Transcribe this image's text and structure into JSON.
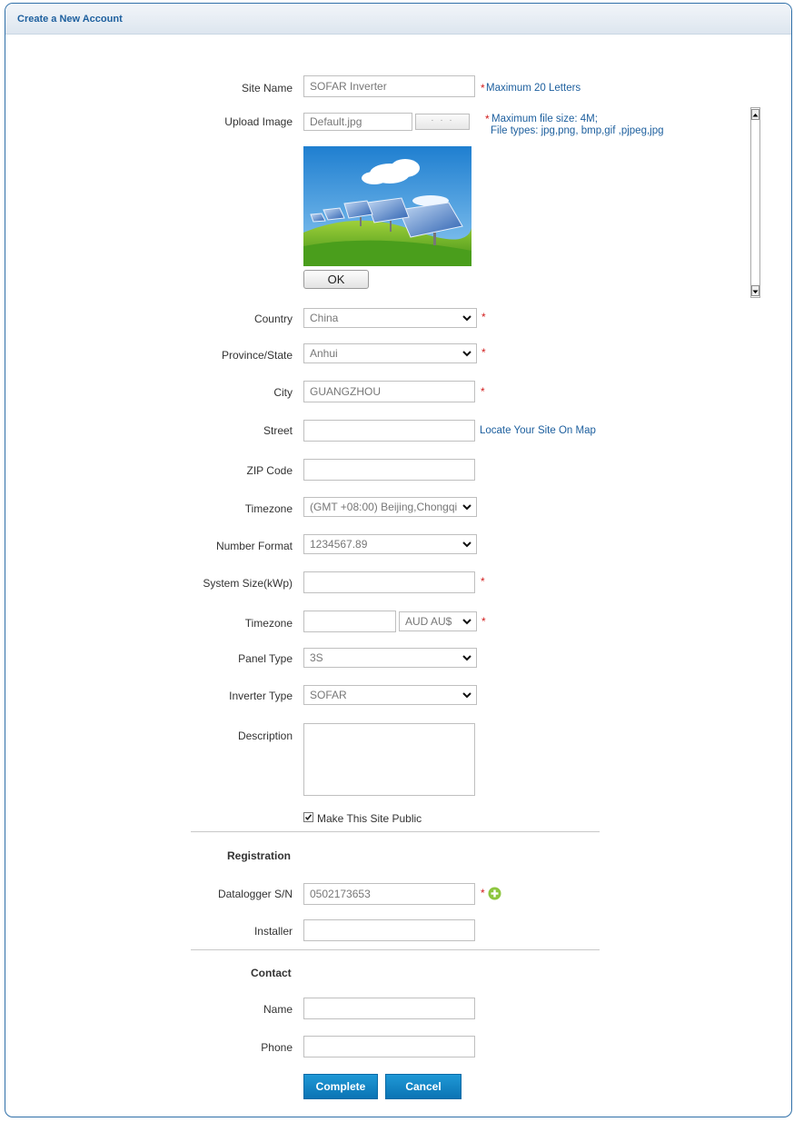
{
  "header": {
    "title": "Create a New Account"
  },
  "site_name": {
    "label": "Site Name",
    "value": "SOFAR Inverter",
    "note": "Maximum 20 Letters"
  },
  "upload_image": {
    "label": "Upload Image",
    "value": "Default.jpg",
    "browse_label": "· · ·",
    "note_line1": "Maximum file size: 4M;",
    "note_line2": "File types: jpg,png, bmp,gif ,pjpeg,jpg",
    "ok_label": "OK"
  },
  "country": {
    "label": "Country",
    "value": "China"
  },
  "province": {
    "label": "Province/State",
    "value": "Anhui"
  },
  "city": {
    "label": "City",
    "value": "GUANGZHOU"
  },
  "street": {
    "label": "Street",
    "value": "",
    "link": "Locate Your Site On Map"
  },
  "zip": {
    "label": "ZIP Code",
    "value": ""
  },
  "timezone": {
    "label": "Timezone",
    "value": "(GMT +08:00) Beijing,Chongqi"
  },
  "number_format": {
    "label": "Number Format",
    "value": "1234567.89"
  },
  "system_size": {
    "label": "System Size(kWp)",
    "value": ""
  },
  "currency": {
    "label": "Timezone",
    "value": "",
    "currency": "AUD AU$"
  },
  "panel_type": {
    "label": "Panel Type",
    "value": "3S"
  },
  "inverter_type": {
    "label": "Inverter Type",
    "value": "SOFAR"
  },
  "description": {
    "label": "Description",
    "value": ""
  },
  "public": {
    "label": "Make This Site Public",
    "checked": true
  },
  "registration": {
    "title": "Registration",
    "datalogger_label": "Datalogger S/N",
    "datalogger_value": "0502173653",
    "installer_label": "Installer",
    "installer_value": ""
  },
  "contact": {
    "title": "Contact",
    "name_label": "Name",
    "name_value": "",
    "phone_label": "Phone",
    "phone_value": ""
  },
  "actions": {
    "complete": "Complete",
    "cancel": "Cancel"
  },
  "required_mark": "*",
  "colors": {
    "accent": "#1d5f9e",
    "required": "#d21d1d",
    "button": "#0b74b4",
    "add_icon": "#8dc63f"
  }
}
